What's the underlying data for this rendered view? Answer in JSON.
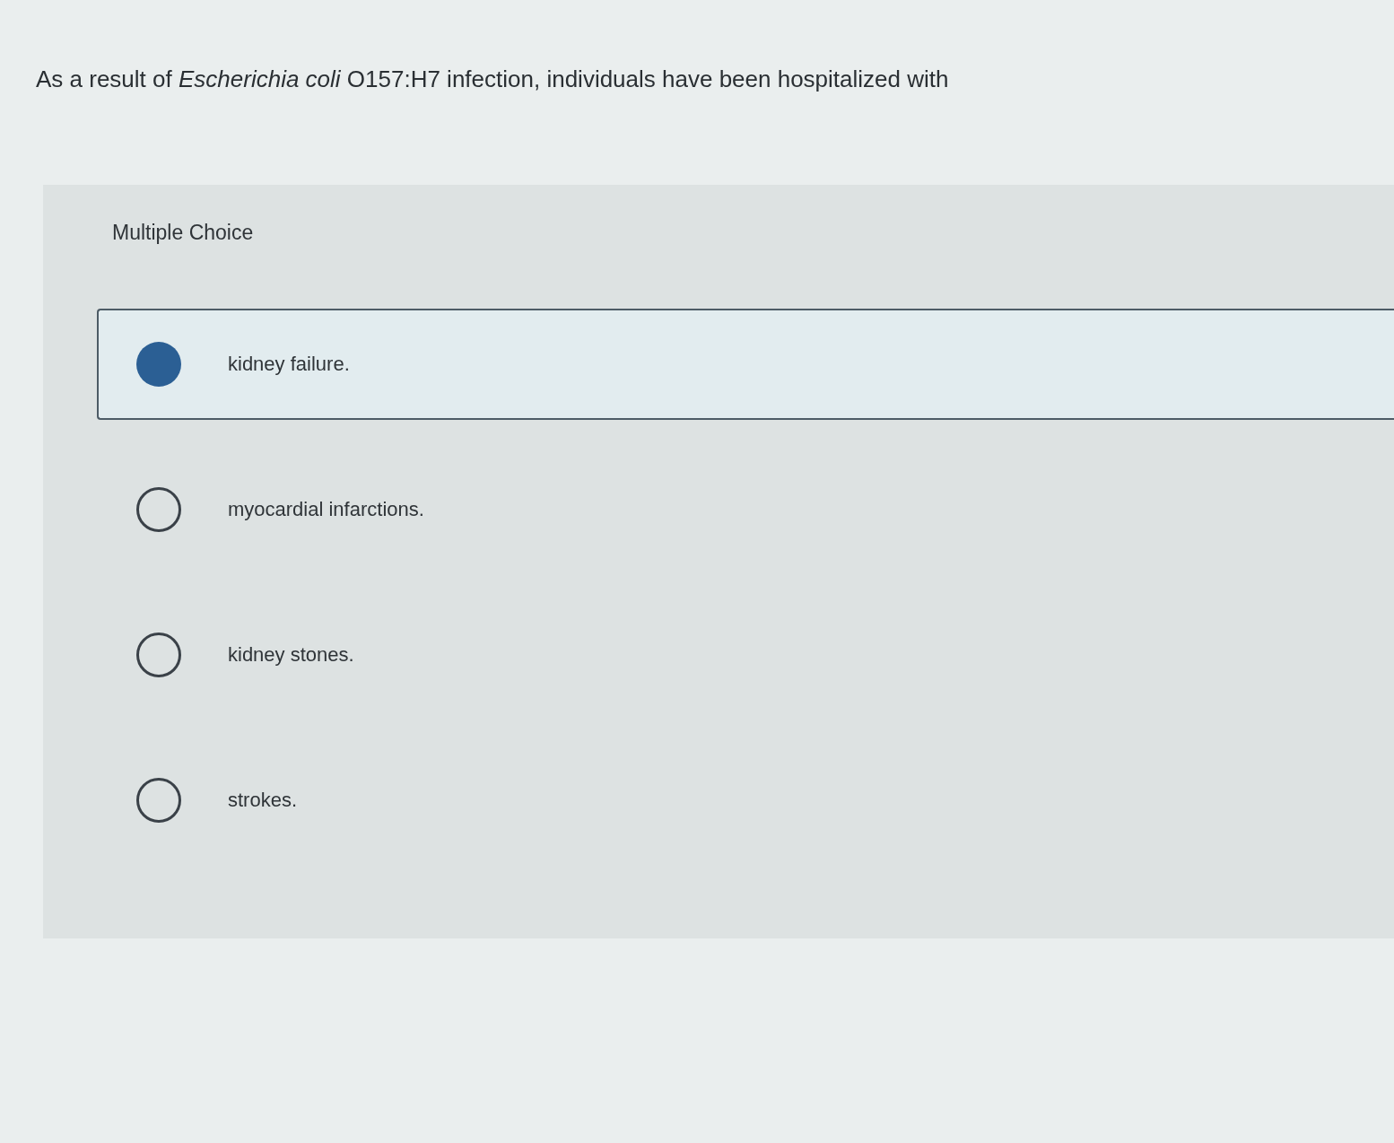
{
  "question": "As a result of *Escherichia coli* O157:H7 infection, individuals have been hospitalized with",
  "answer_panel": {
    "heading": "Multiple Choice",
    "options": [
      {
        "label": "kidney failure.",
        "selected": true
      },
      {
        "label": "myocardial infarctions.",
        "selected": false
      },
      {
        "label": "kidney stones.",
        "selected": false
      },
      {
        "label": "strokes.",
        "selected": false
      }
    ]
  }
}
